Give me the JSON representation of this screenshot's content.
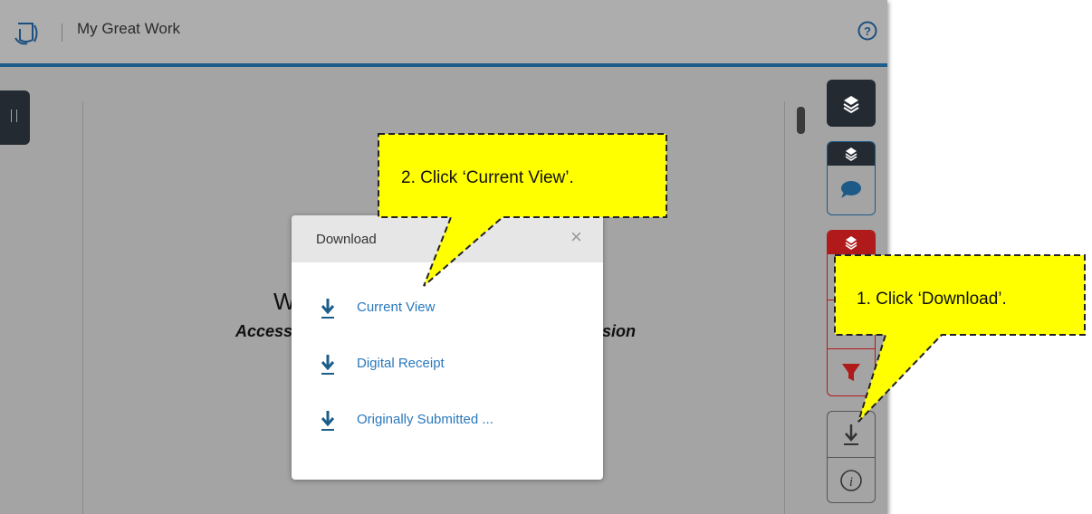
{
  "header": {
    "title": "My Great Work",
    "logo_icon": "feedback-studio-logo-icon",
    "help_icon": "help-icon"
  },
  "document": {
    "line1": "W",
    "line2_left": "Access",
    "line2_right": "sion"
  },
  "download_modal": {
    "title": "Download",
    "close_label": "×",
    "items": [
      {
        "label": "Current View",
        "icon": "download-icon"
      },
      {
        "label": "Digital Receipt",
        "icon": "download-icon"
      },
      {
        "label": "Originally Submitted ...",
        "icon": "download-icon"
      }
    ]
  },
  "callouts": [
    {
      "text": "2. Click ‘Current View’."
    },
    {
      "text": "1. Click ‘Download’."
    }
  ],
  "colors": {
    "accent": "#1c5d8a",
    "link": "#2a78bd",
    "callout": "#ffff00",
    "danger": "#b01a1a",
    "dark": "#232a31"
  }
}
